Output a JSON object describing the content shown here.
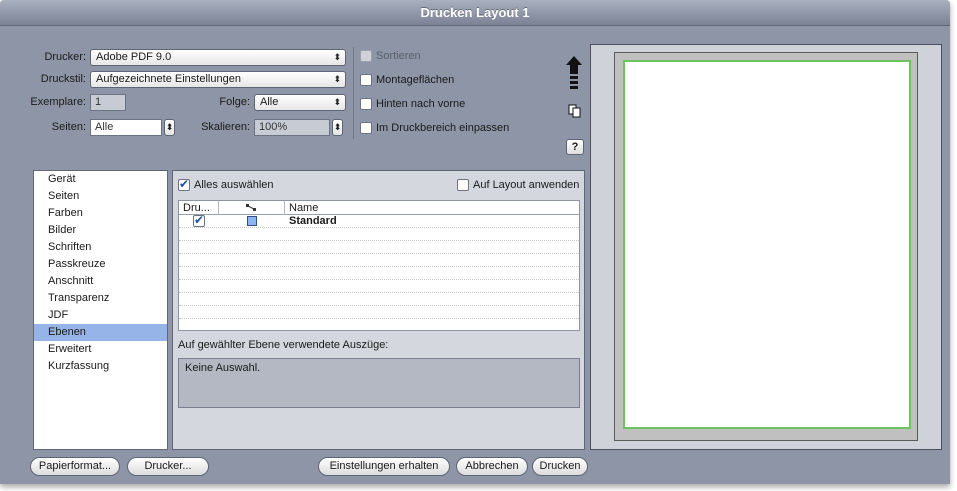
{
  "window": {
    "title": "Drucken Layout 1"
  },
  "settings": {
    "drucker_label": "Drucker:",
    "drucker_value": "Adobe PDF 9.0",
    "druckstil_label": "Druckstil:",
    "druckstil_value": "Aufgezeichnete Einstellungen",
    "exemplare_label": "Exemplare:",
    "exemplare_value": "1",
    "folge_label": "Folge:",
    "folge_value": "Alle",
    "seiten_label": "Seiten:",
    "seiten_value": "Alle",
    "skalieren_label": "Skalieren:",
    "skalieren_value": "100%"
  },
  "options": {
    "sortieren": "Sortieren",
    "montageflaechen": "Montageflächen",
    "hinten_nach_vorne": "Hinten nach vorne",
    "im_druckbereich": "Im Druckbereich einpassen",
    "help": "?"
  },
  "sidebar": {
    "items": [
      {
        "label": "Gerät"
      },
      {
        "label": "Seiten"
      },
      {
        "label": "Farben"
      },
      {
        "label": "Bilder"
      },
      {
        "label": "Schriften"
      },
      {
        "label": "Passkreuze"
      },
      {
        "label": "Anschnitt"
      },
      {
        "label": "Transparenz"
      },
      {
        "label": "JDF"
      },
      {
        "label": "Ebenen"
      },
      {
        "label": "Erweitert"
      },
      {
        "label": "Kurzfassung"
      }
    ],
    "selected": "Ebenen"
  },
  "panel": {
    "select_all": "Alles auswählen",
    "apply_layout": "Auf Layout anwenden",
    "columns": [
      "Dru...",
      "",
      "Name"
    ],
    "rows": [
      {
        "name": "Standard"
      }
    ],
    "separations_label": "Auf gewählter Ebene verwendete Auszüge:",
    "separations_value": "Keine Auswahl."
  },
  "buttons": {
    "papierformat": "Papierformat...",
    "drucker": "Drucker...",
    "einstellungen": "Einstellungen erhalten",
    "abbrechen": "Abbrechen",
    "drucken": "Drucken"
  },
  "colors": {
    "window_bg": "#8d95a6",
    "selection": "#96b4e8",
    "page_border": "#6cc25e",
    "layer_color": "#8cb4ee"
  }
}
